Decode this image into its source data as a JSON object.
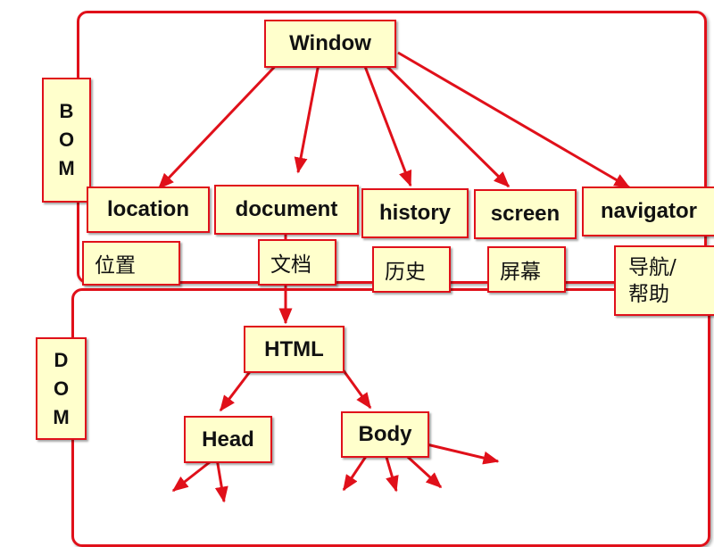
{
  "diagram": {
    "bom": {
      "label_letters": [
        "B",
        "O",
        "M"
      ]
    },
    "dom": {
      "label_letters": [
        "D",
        "O",
        "M"
      ]
    },
    "window": {
      "label": "Window"
    },
    "bom_objects": {
      "location": {
        "label": "location",
        "desc": "位置"
      },
      "document": {
        "label": "document",
        "desc": "文档"
      },
      "history": {
        "label": "history",
        "desc": "历史"
      },
      "screen": {
        "label": "screen",
        "desc": "屏幕"
      },
      "navigator": {
        "label": "navigator",
        "desc_line1": "导航/",
        "desc_line2": "帮助"
      }
    },
    "dom_tree": {
      "html": {
        "label": "HTML"
      },
      "head": {
        "label": "Head"
      },
      "body": {
        "label": "Body"
      }
    }
  },
  "colors": {
    "border": "#e0101a",
    "box_fill": "#ffffcc",
    "arrow": "#e0101a",
    "text": "#111111"
  }
}
